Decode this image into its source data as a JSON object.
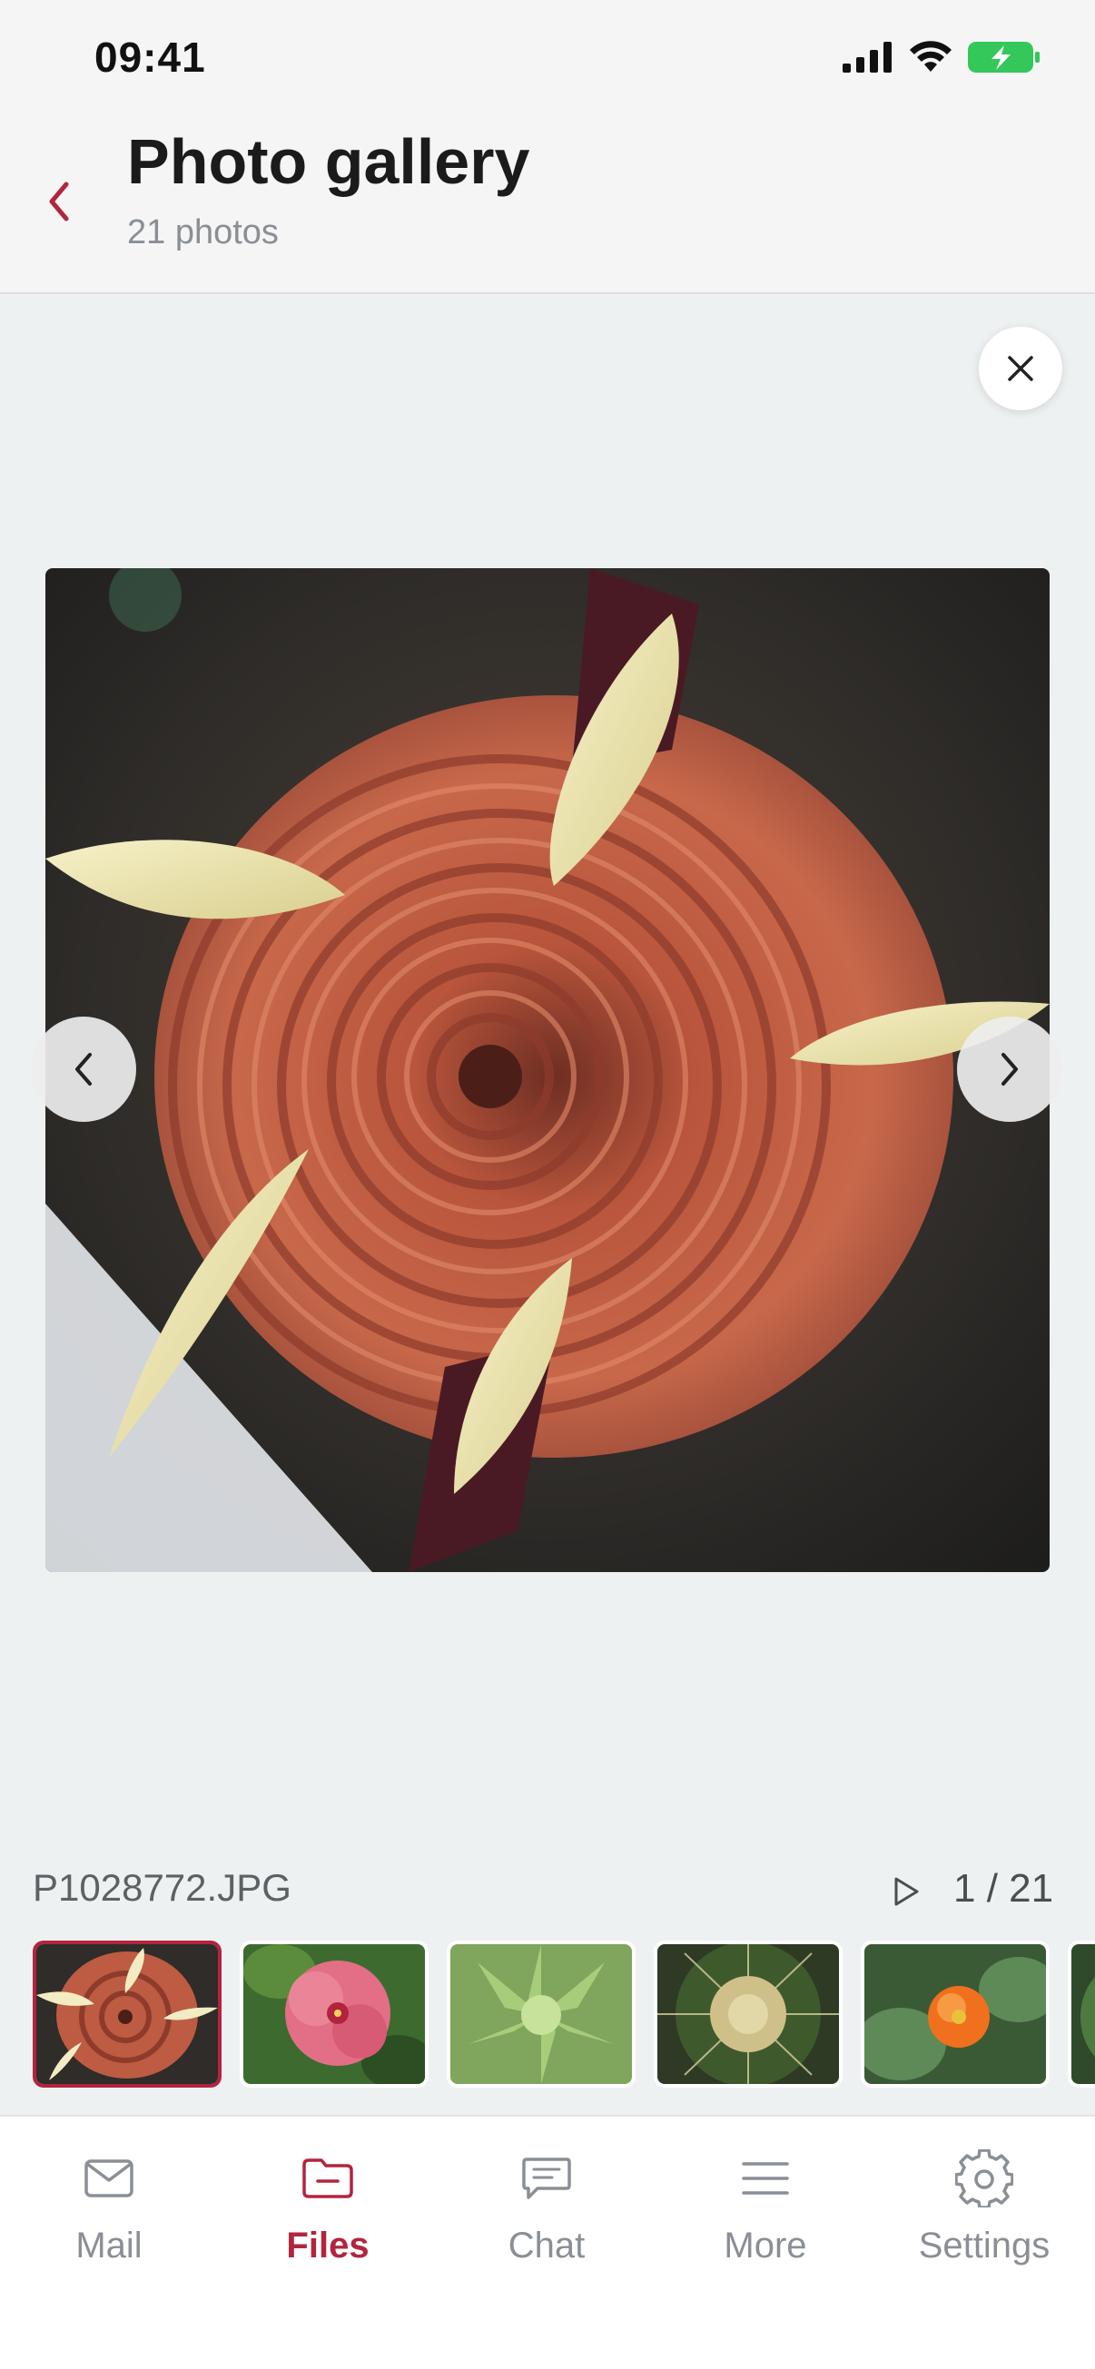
{
  "status_bar": {
    "time": "09:41"
  },
  "header": {
    "title": "Photo gallery",
    "subtitle": "21 photos"
  },
  "viewer": {
    "filename": "P1028772.JPG",
    "counter": "1 / 21",
    "current_index": 1,
    "total": 21
  },
  "thumbnails": [
    "rose-succulent",
    "pink-hibiscus",
    "green-aloe",
    "barrel-cactus",
    "orange-cactus-flower",
    "green-succulent"
  ],
  "tabs": [
    {
      "label": "Mail",
      "icon": "mail-icon",
      "active": false
    },
    {
      "label": "Files",
      "icon": "folder-icon",
      "active": true
    },
    {
      "label": "Chat",
      "icon": "chat-icon",
      "active": false
    },
    {
      "label": "More",
      "icon": "menu-icon",
      "active": false
    },
    {
      "label": "Settings",
      "icon": "gear-icon",
      "active": false
    }
  ],
  "colors": {
    "accent": "#b3243e",
    "muted": "#8a8f95",
    "battery": "#34c759"
  }
}
